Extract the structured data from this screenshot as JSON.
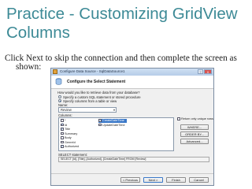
{
  "slide": {
    "title": "Practice - Customizing GridView Columns",
    "body_line1": "Click Next to skip the connection and then complete the screen as",
    "body_line2": "shown:"
  },
  "dialog": {
    "window_title": "Configure Data Source - SqlDataSource1",
    "window_buttons": {
      "help": "?",
      "close": "X"
    },
    "header": "Configure the Select Statement",
    "question": "How would you like to retrieve data from your database?",
    "options": [
      {
        "label": "Specify a custom SQL statement or stored procedure",
        "selected": false
      },
      {
        "label": "Specify columns from a table or view",
        "selected": true
      }
    ],
    "name_label": "Name:",
    "name_value": "Review",
    "columns_label": "Columns:",
    "columns_left": [
      {
        "label": "*",
        "checked": false
      },
      {
        "label": "Id",
        "checked": true
      },
      {
        "label": "Title",
        "checked": true
      },
      {
        "label": "Summary",
        "checked": false
      },
      {
        "label": "Body",
        "checked": false
      },
      {
        "label": "GenreId",
        "checked": false
      },
      {
        "label": "Authorized",
        "checked": true
      }
    ],
    "columns_right": [
      {
        "label": "CreateDateTime",
        "checked": true,
        "highlighted": true
      },
      {
        "label": "UpdateDateTime",
        "checked": false,
        "highlighted": false
      }
    ],
    "return_unique": {
      "label": "Return only unique rows",
      "checked": false
    },
    "side_buttons": [
      "WHERE...",
      "ORDER BY...",
      "Advanced..."
    ],
    "select_label": "SELECT statement:",
    "select_statement": "SELECT [Id], [Title], [Authorized], [CreateDateTime] FROM [Review]",
    "footer_buttons": [
      "< Previous",
      "Next >",
      "Finish",
      "Cancel"
    ]
  }
}
